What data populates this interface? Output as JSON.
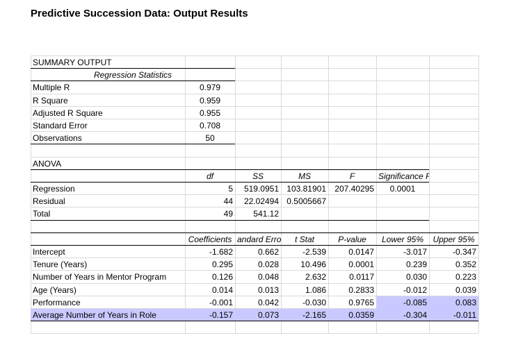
{
  "title": "Predictive Succession Data: Output Results",
  "summary": {
    "heading": "SUMMARY OUTPUT",
    "reg_stats_heading": "Regression Statistics",
    "rows": [
      {
        "label": "Multiple R",
        "value": "0.979"
      },
      {
        "label": "R Square",
        "value": "0.959"
      },
      {
        "label": "Adjusted R Square",
        "value": "0.955"
      },
      {
        "label": "Standard Error",
        "value": "0.708"
      },
      {
        "label": "Observations",
        "value": "50"
      }
    ]
  },
  "anova": {
    "heading": "ANOVA",
    "headers": [
      "df",
      "SS",
      "MS",
      "F",
      "Significance F"
    ],
    "rows": [
      {
        "label": "Regression",
        "df": "5",
        "ss": "519.0951",
        "ms": "103.81901",
        "f": "207.40295",
        "sig": "0.0001"
      },
      {
        "label": "Residual",
        "df": "44",
        "ss": "22.02494",
        "ms": "0.5005667",
        "f": "",
        "sig": ""
      },
      {
        "label": "Total",
        "df": "49",
        "ss": "541.12",
        "ms": "",
        "f": "",
        "sig": ""
      }
    ]
  },
  "coefficients": {
    "headers": [
      "Coefficients",
      "andard Erro",
      "t Stat",
      "P-value",
      "Lower 95%",
      "Upper 95%"
    ],
    "rows": [
      {
        "label": "Intercept",
        "coef": "-1.682",
        "se": "0.662",
        "t": "-2.539",
        "p": "0.0147",
        "lo": "-3.017",
        "hi": "-0.347"
      },
      {
        "label": "Tenure (Years)",
        "coef": "0.295",
        "se": "0.028",
        "t": "10.496",
        "p": "0.0001",
        "lo": "0.239",
        "hi": "0.352"
      },
      {
        "label": "Number of Years in Mentor Program",
        "coef": "0.126",
        "se": "0.048",
        "t": "2.632",
        "p": "0.0117",
        "lo": "0.030",
        "hi": "0.223"
      },
      {
        "label": "Age (Years)",
        "coef": "0.014",
        "se": "0.013",
        "t": "1.086",
        "p": "0.2833",
        "lo": "-0.012",
        "hi": "0.039"
      },
      {
        "label": "Performance",
        "coef": "-0.001",
        "se": "0.042",
        "t": "-0.030",
        "p": "0.9765",
        "lo": "-0.085",
        "hi": "0.083"
      },
      {
        "label": "Average Number of Years in Role",
        "coef": "-0.157",
        "se": "0.073",
        "t": "-2.165",
        "p": "0.0359",
        "lo": "-0.304",
        "hi": "-0.011"
      }
    ]
  },
  "colors": {
    "highlight": "#c9c9ff",
    "gridline": "#d9d9d9"
  }
}
